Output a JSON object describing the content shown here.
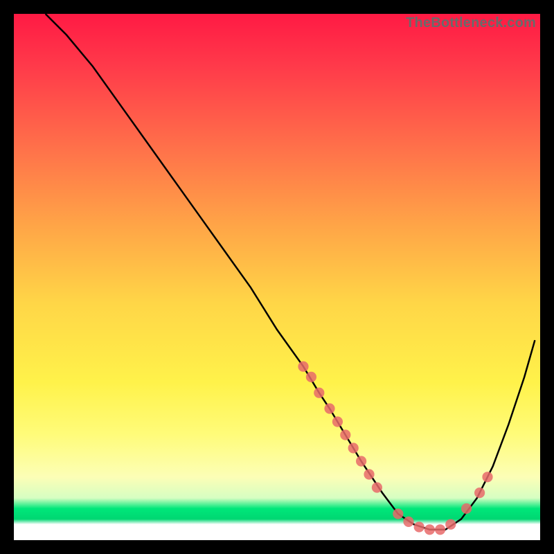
{
  "watermark": "TheBottleneck.com",
  "chart_data": {
    "type": "line",
    "title": "",
    "xlabel": "",
    "ylabel": "",
    "xlim": [
      0,
      100
    ],
    "ylim": [
      0,
      100
    ],
    "grid": false,
    "legend": false,
    "annotations": [],
    "series": [
      {
        "name": "curve",
        "color": "#000000",
        "x": [
          6,
          10,
          15,
          20,
          25,
          30,
          35,
          40,
          45,
          50,
          55,
          58,
          60,
          63,
          66,
          70,
          73,
          76,
          79,
          82,
          85,
          88,
          91,
          94,
          97,
          99
        ],
        "y": [
          100,
          96,
          90,
          83,
          76,
          69,
          62,
          55,
          48,
          40,
          33,
          28,
          25,
          20,
          15,
          9,
          5,
          3,
          2,
          2,
          4,
          8,
          14,
          22,
          31,
          38
        ]
      }
    ],
    "markers": {
      "color": "#e86a6a",
      "radius_world": 1.0,
      "points": [
        {
          "x": 55,
          "y": 33
        },
        {
          "x": 56.5,
          "y": 31
        },
        {
          "x": 58,
          "y": 28
        },
        {
          "x": 60,
          "y": 25
        },
        {
          "x": 61.5,
          "y": 22.5
        },
        {
          "x": 63,
          "y": 20
        },
        {
          "x": 64.5,
          "y": 17.5
        },
        {
          "x": 66,
          "y": 15
        },
        {
          "x": 67.5,
          "y": 12.5
        },
        {
          "x": 69,
          "y": 10
        },
        {
          "x": 73,
          "y": 5
        },
        {
          "x": 75,
          "y": 3.5
        },
        {
          "x": 77,
          "y": 2.5
        },
        {
          "x": 79,
          "y": 2
        },
        {
          "x": 81,
          "y": 2
        },
        {
          "x": 83,
          "y": 3
        },
        {
          "x": 86,
          "y": 6
        },
        {
          "x": 88.5,
          "y": 9
        },
        {
          "x": 90,
          "y": 12
        }
      ]
    }
  }
}
